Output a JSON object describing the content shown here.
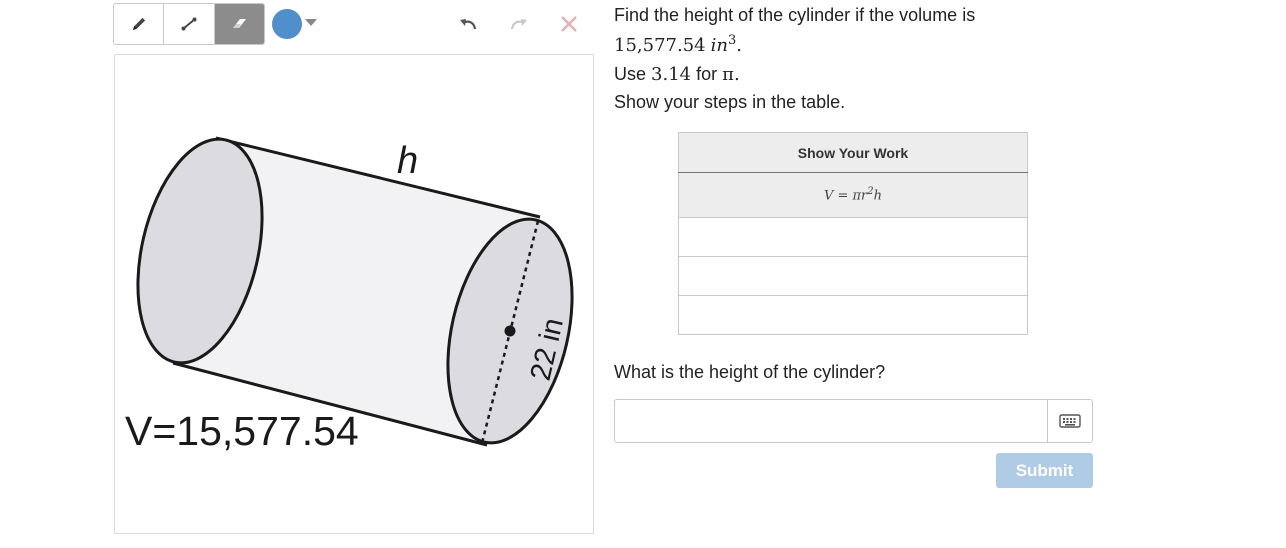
{
  "toolbar": {
    "tools": [
      {
        "icon": "pencil-icon",
        "active": false
      },
      {
        "icon": "line-icon",
        "active": false
      },
      {
        "icon": "eraser-icon",
        "active": true
      }
    ],
    "color": "#4f8fcb",
    "undo_icon": "undo-icon",
    "redo_icon": "redo-icon",
    "clear_icon": "clear-icon"
  },
  "figure": {
    "height_label": "h",
    "diameter_label": "22 in",
    "volume_label": "V=15,577.54"
  },
  "question": {
    "line1": "Find the height of the cylinder if the volume is",
    "volume_value": "15,577.54",
    "volume_unit": "in",
    "volume_exp": "3",
    "line2_prefix": "Use",
    "pi_value": "3.14",
    "line2_mid": "for",
    "pi_symbol": "π",
    "line3": "Show your steps in the table."
  },
  "work_table": {
    "header": "Show Your Work",
    "formula": {
      "lhs": "V = πr",
      "exp": "2",
      "rhs": "h"
    },
    "blank_rows": 3
  },
  "answer": {
    "prompt": "What is the height of the cylinder?",
    "value": "",
    "keyboard_icon": "keyboard-icon"
  },
  "submit": {
    "label": "Submit",
    "color": "#b0cbe6"
  }
}
